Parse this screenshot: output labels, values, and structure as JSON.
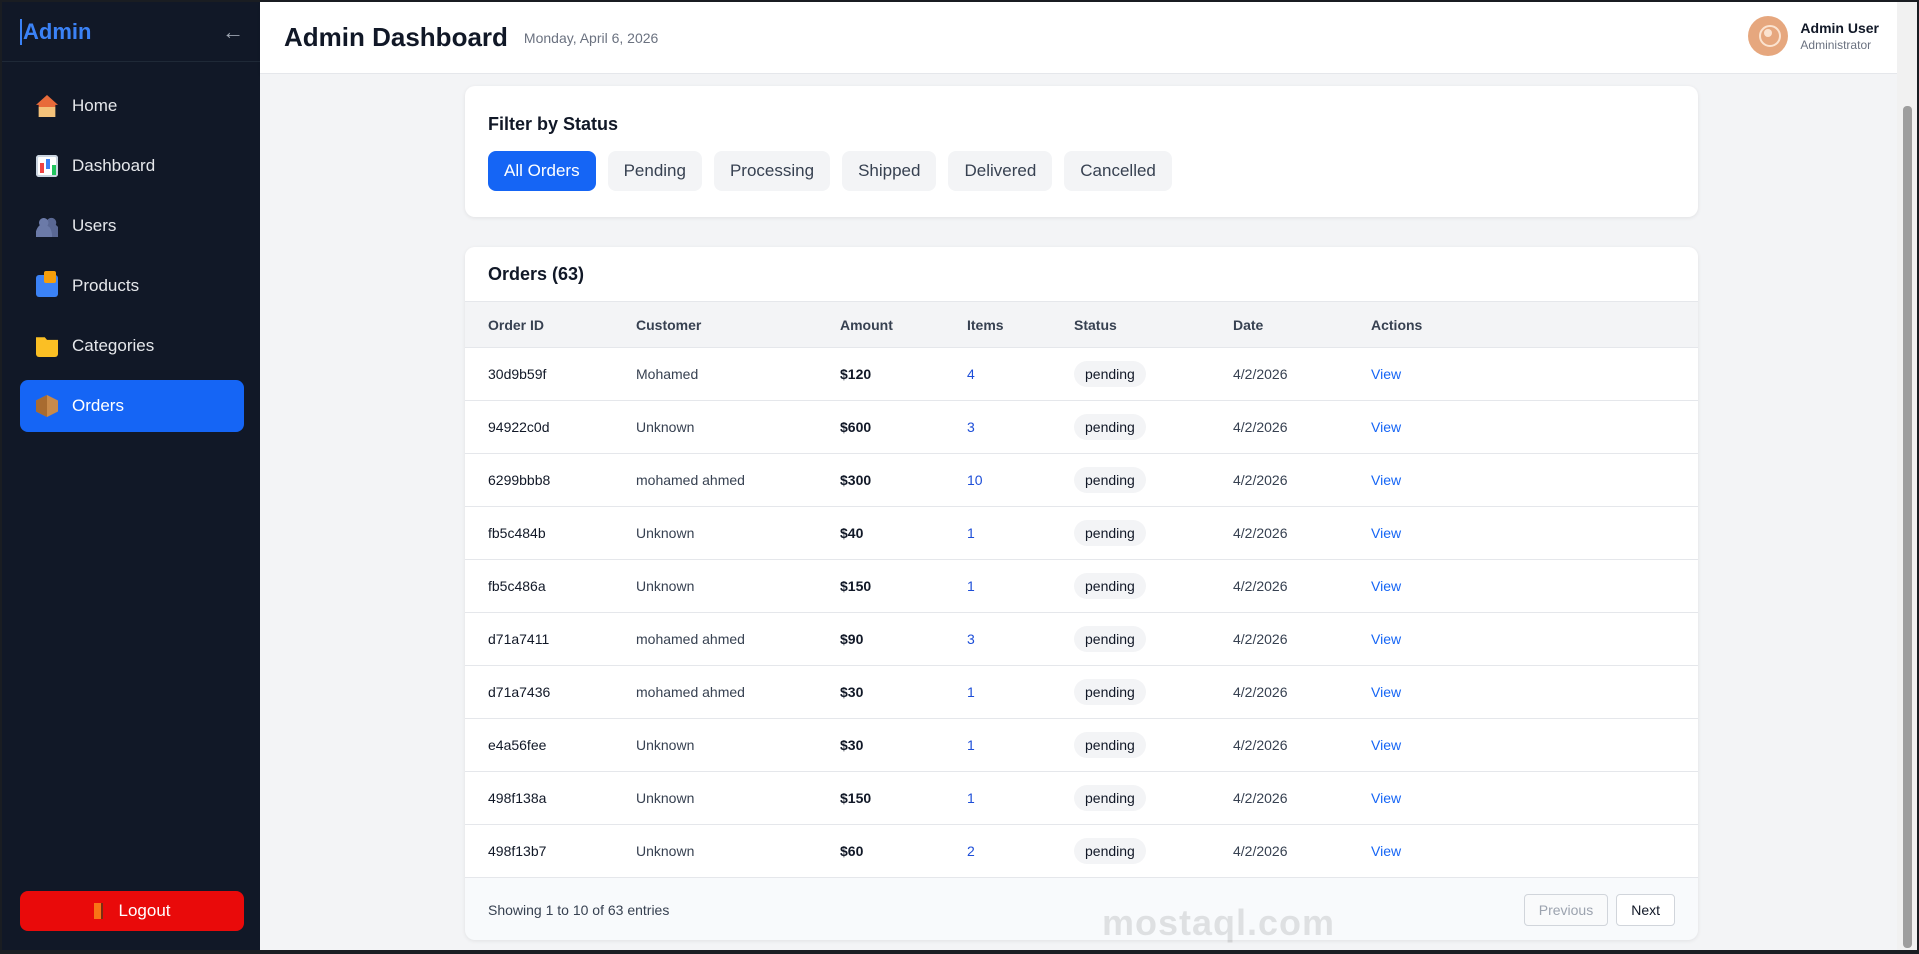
{
  "sidebar": {
    "brand": "Admin",
    "collapse_icon": "←",
    "items": [
      {
        "label": "Home",
        "icon": "home-icon"
      },
      {
        "label": "Dashboard",
        "icon": "chart-icon"
      },
      {
        "label": "Users",
        "icon": "users-icon"
      },
      {
        "label": "Products",
        "icon": "shopping-bags-icon"
      },
      {
        "label": "Categories",
        "icon": "folder-icon"
      },
      {
        "label": "Orders",
        "icon": "package-icon",
        "active": true
      }
    ],
    "logout_label": "Logout"
  },
  "header": {
    "title": "Admin Dashboard",
    "date": "Monday, April 6, 2026",
    "user_name": "Admin User",
    "user_role": "Administrator"
  },
  "filter": {
    "title": "Filter by Status",
    "buttons": [
      "All Orders",
      "Pending",
      "Processing",
      "Shipped",
      "Delivered",
      "Cancelled"
    ],
    "active": "All Orders"
  },
  "orders": {
    "title": "Orders (63)",
    "columns": [
      "Order ID",
      "Customer",
      "Amount",
      "Items",
      "Status",
      "Date",
      "Actions"
    ],
    "rows": [
      {
        "id": "30d9b59f",
        "customer": "Mohamed",
        "amount": "$120",
        "items": "4",
        "status": "pending",
        "date": "4/2/2026",
        "action": "View"
      },
      {
        "id": "94922c0d",
        "customer": "Unknown",
        "amount": "$600",
        "items": "3",
        "status": "pending",
        "date": "4/2/2026",
        "action": "View"
      },
      {
        "id": "6299bbb8",
        "customer": "mohamed ahmed",
        "amount": "$300",
        "items": "10",
        "status": "pending",
        "date": "4/2/2026",
        "action": "View"
      },
      {
        "id": "fb5c484b",
        "customer": "Unknown",
        "amount": "$40",
        "items": "1",
        "status": "pending",
        "date": "4/2/2026",
        "action": "View"
      },
      {
        "id": "fb5c486a",
        "customer": "Unknown",
        "amount": "$150",
        "items": "1",
        "status": "pending",
        "date": "4/2/2026",
        "action": "View"
      },
      {
        "id": "d71a7411",
        "customer": "mohamed ahmed",
        "amount": "$90",
        "items": "3",
        "status": "pending",
        "date": "4/2/2026",
        "action": "View"
      },
      {
        "id": "d71a7436",
        "customer": "mohamed ahmed",
        "amount": "$30",
        "items": "1",
        "status": "pending",
        "date": "4/2/2026",
        "action": "View"
      },
      {
        "id": "e4a56fee",
        "customer": "Unknown",
        "amount": "$30",
        "items": "1",
        "status": "pending",
        "date": "4/2/2026",
        "action": "View"
      },
      {
        "id": "498f138a",
        "customer": "Unknown",
        "amount": "$150",
        "items": "1",
        "status": "pending",
        "date": "4/2/2026",
        "action": "View"
      },
      {
        "id": "498f13b7",
        "customer": "Unknown",
        "amount": "$60",
        "items": "2",
        "status": "pending",
        "date": "4/2/2026",
        "action": "View"
      }
    ],
    "entries_text": "Showing 1 to 10 of 63 entries",
    "prev_label": "Previous",
    "next_label": "Next"
  },
  "watermark": "mostaql.com",
  "colors": {
    "sidebar_bg": "#111827",
    "accent": "#1565f5",
    "logout": "#e90a0a"
  }
}
